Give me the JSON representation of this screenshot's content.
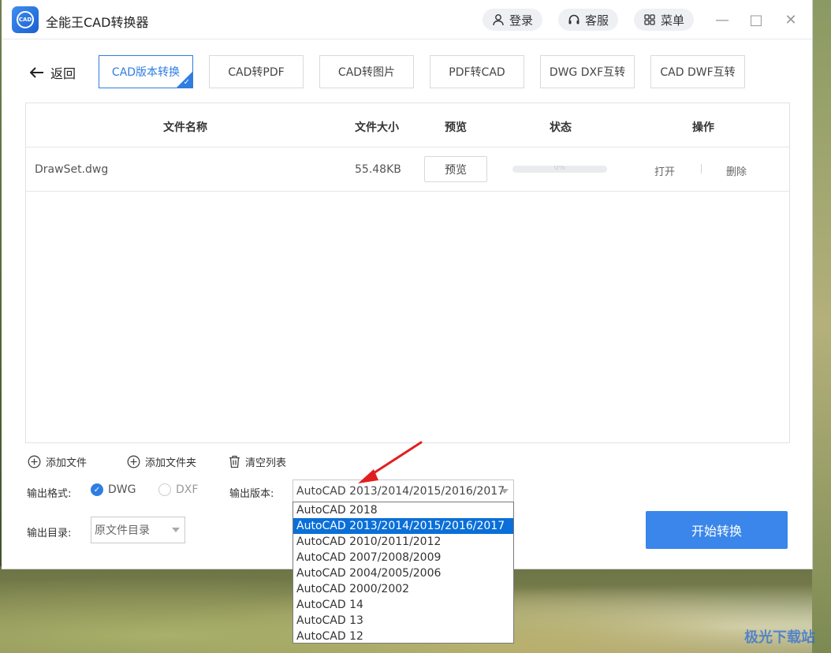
{
  "app": {
    "title": "全能王CAD转换器",
    "logo_text": "CAD"
  },
  "header": {
    "login": "登录",
    "service": "客服",
    "menu": "菜单"
  },
  "window_controls": {
    "minimize": "—",
    "maximize": "□",
    "close": "✕"
  },
  "nav": {
    "back": "返回",
    "tabs": [
      {
        "label": "CAD版本转换",
        "active": true
      },
      {
        "label": "CAD转PDF",
        "active": false
      },
      {
        "label": "CAD转图片",
        "active": false
      },
      {
        "label": "PDF转CAD",
        "active": false
      },
      {
        "label": "DWG DXF互转",
        "active": false
      },
      {
        "label": "CAD DWF互转",
        "active": false
      }
    ]
  },
  "table": {
    "headers": {
      "name": "文件名称",
      "size": "文件大小",
      "preview": "预览",
      "status": "状态",
      "ops": "操作"
    },
    "rows": [
      {
        "name": "DrawSet.dwg",
        "size": "55.48KB",
        "preview": "预览",
        "progress": 0,
        "progress_text": "0%",
        "open": "打开",
        "delete": "删除"
      }
    ]
  },
  "actions": {
    "add_file": "添加文件",
    "add_folder": "添加文件夹",
    "clear": "清空列表"
  },
  "output": {
    "format_label": "输出格式:",
    "formats": [
      {
        "label": "DWG",
        "selected": true
      },
      {
        "label": "DXF",
        "selected": false
      }
    ],
    "version_label": "输出版本:",
    "version_value": "AutoCAD 2013/2014/2015/2016/2017",
    "dir_label": "输出目录:",
    "dir_value": "原文件目录"
  },
  "dropdown": {
    "options": [
      "AutoCAD 2018",
      "AutoCAD 2013/2014/2015/2016/2017",
      "AutoCAD 2010/2011/2012",
      "AutoCAD 2007/2008/2009",
      "AutoCAD 2004/2005/2006",
      "AutoCAD 2000/2002",
      "AutoCAD 14",
      "AutoCAD 13",
      "AutoCAD 12"
    ],
    "selected_index": 1
  },
  "start_button": "开始转换",
  "watermark": "极光下载站",
  "colors": {
    "accent": "#2f7de1",
    "button": "#3a86ea",
    "highlight": "#0a6fd8",
    "arrow": "#e02020"
  }
}
